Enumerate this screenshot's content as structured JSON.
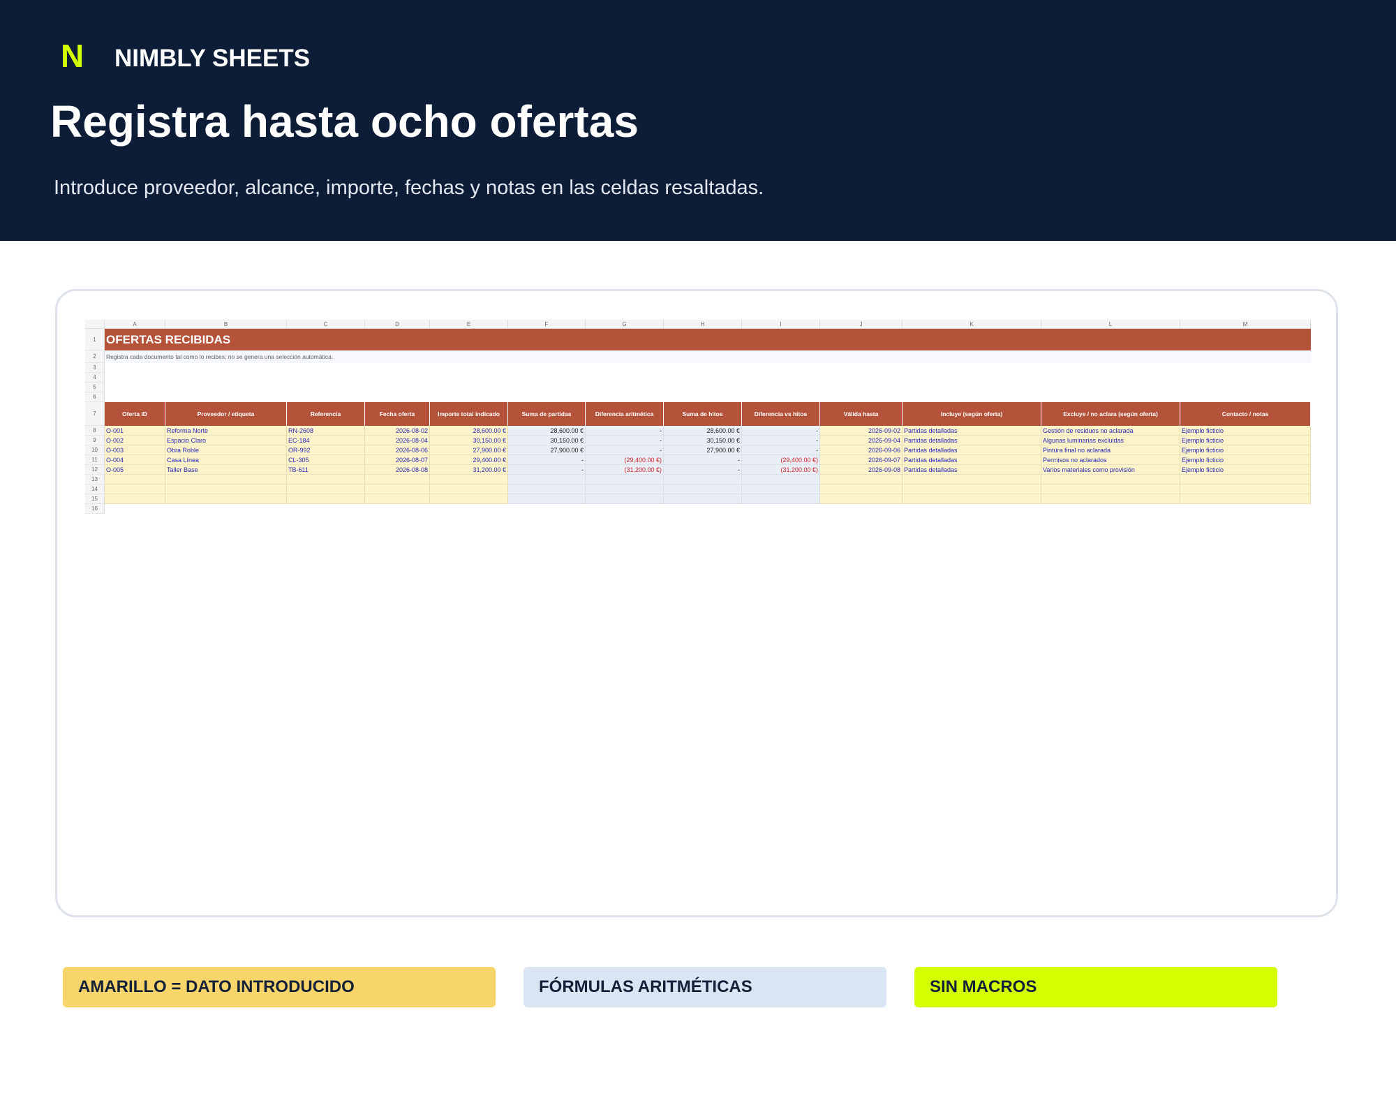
{
  "brand": {
    "mark": "N",
    "name": "NIMBLY SHEETS"
  },
  "hero": {
    "title": "Registra hasta ocho ofertas",
    "subtitle": "Introduce proveedor, alcance, importe, fechas y notas en las celdas resaltadas."
  },
  "sheet": {
    "columns": [
      "A",
      "B",
      "C",
      "D",
      "E",
      "F",
      "G",
      "H",
      "I",
      "J",
      "K",
      "L",
      "M"
    ],
    "row_numbers": [
      "1",
      "2",
      "3",
      "4",
      "5",
      "6",
      "7",
      "8",
      "9",
      "10",
      "11",
      "12",
      "13",
      "14",
      "15",
      "16"
    ],
    "title": "OFERTAS RECIBIDAS",
    "note": "Registra cada documento tal como lo recibes; no se genera una selección automática.",
    "headers": [
      "Oferta ID",
      "Proveedor / etiqueta",
      "Referencia",
      "Fecha oferta",
      "Importe total indicado",
      "Suma de partidas",
      "Diferencia aritmética",
      "Suma de hitos",
      "Diferencia vs hitos",
      "Válida hasta",
      "Incluye (según oferta)",
      "Excluye / no aclara (según oferta)",
      "Contacto / notas"
    ],
    "rows": [
      [
        "O-001",
        "Reforma Norte",
        "RN-2608",
        "2026-08-02",
        "28,600.00 €",
        "28,600.00 €",
        "-",
        "28,600.00 €",
        "-",
        "2026-09-02",
        "Partidas detalladas",
        "Gestión de residuos no aclarada",
        "Ejemplo ficticio"
      ],
      [
        "O-002",
        "Espacio Claro",
        "EC-184",
        "2026-08-04",
        "30,150.00 €",
        "30,150.00 €",
        "-",
        "30,150.00 €",
        "-",
        "2026-09-04",
        "Partidas detalladas",
        "Algunas luminarias excluidas",
        "Ejemplo ficticio"
      ],
      [
        "O-003",
        "Obra Roble",
        "OR-992",
        "2026-08-06",
        "27,900.00 €",
        "27,900.00 €",
        "-",
        "27,900.00 €",
        "-",
        "2026-09-06",
        "Partidas detalladas",
        "Pintura final no aclarada",
        "Ejemplo ficticio"
      ],
      [
        "O-004",
        "Casa Línea",
        "CL-305",
        "2026-08-07",
        "29,400.00 €",
        "-",
        "(29,400.00 €)",
        "-",
        "(29,400.00 €)",
        "2026-09-07",
        "Partidas detalladas",
        "Permisos no aclarados",
        "Ejemplo ficticio"
      ],
      [
        "O-005",
        "Taller Base",
        "TB-611",
        "2026-08-08",
        "31,200.00 €",
        "-",
        "(31,200.00 €)",
        "-",
        "(31,200.00 €)",
        "2026-09-08",
        "Partidas detalladas",
        "Varios materiales como provisión",
        "Ejemplo ficticio"
      ],
      [
        "",
        "",
        "",
        "",
        "",
        "",
        "",
        "",
        "",
        "",
        "",
        "",
        ""
      ],
      [
        "",
        "",
        "",
        "",
        "",
        "",
        "",
        "",
        "",
        "",
        "",
        "",
        ""
      ],
      [
        "",
        "",
        "",
        "",
        "",
        "",
        "",
        "",
        "",
        "",
        "",
        "",
        ""
      ]
    ]
  },
  "legend": {
    "input_chip": "AMARILLO = DATO INTRODUCIDO",
    "formula_chip": "FÓRMULAS ARITMÉTICAS",
    "macro_chip": "SIN MACROS"
  },
  "colors": {
    "header_bg": "#0d1d38",
    "accent": "#d4ff00",
    "sheet_header": "#b5533a",
    "input_fill": "#fcf3c9",
    "formula_fill": "#e9eef5",
    "negative": "#d0202a"
  }
}
